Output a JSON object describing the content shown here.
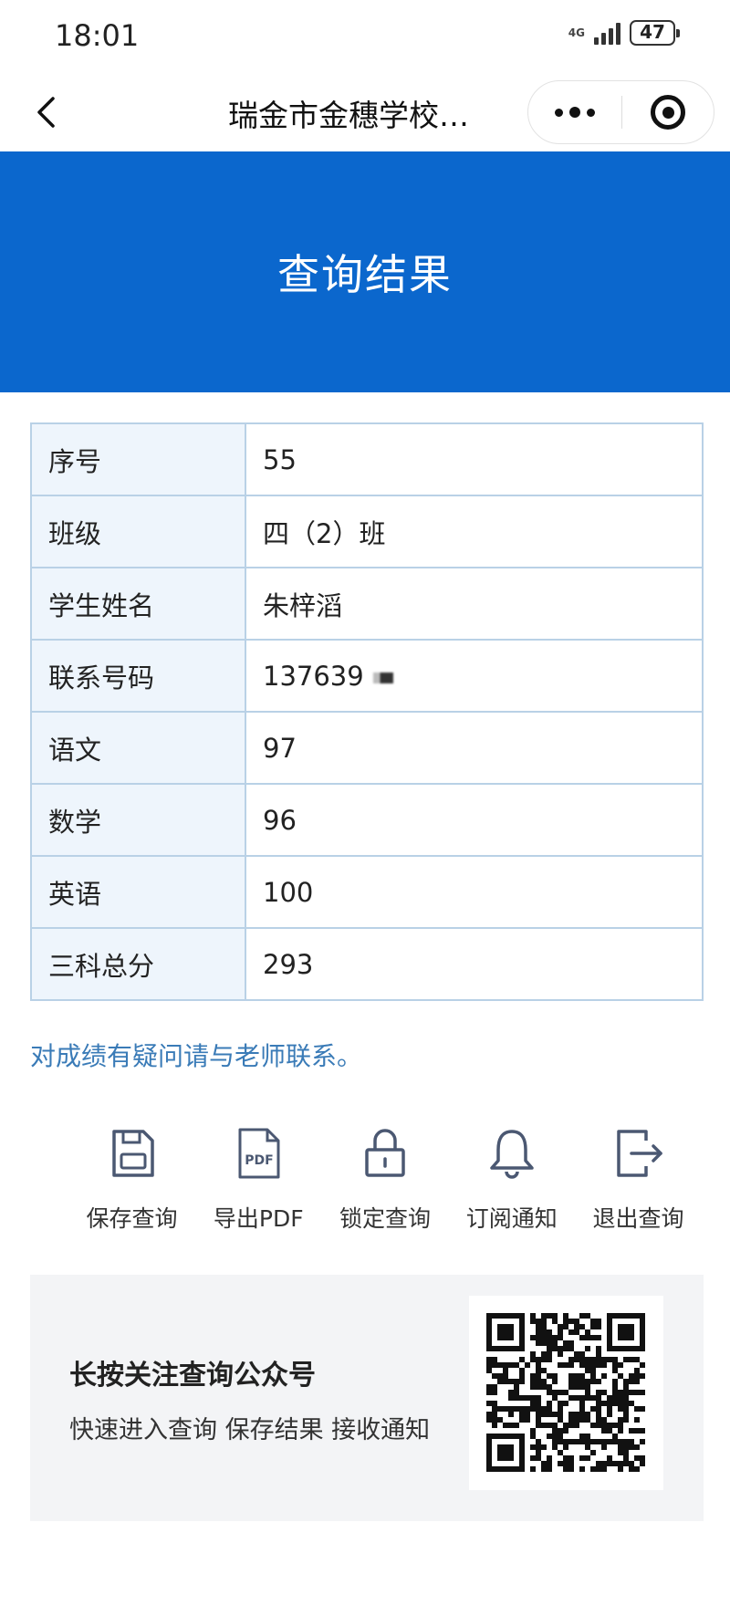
{
  "status_bar": {
    "time": "18:01",
    "network": "4G",
    "battery": "47"
  },
  "nav": {
    "title": "瑞金市金穗学校…"
  },
  "banner": {
    "title": "查询结果"
  },
  "result_rows": [
    {
      "label": "序号",
      "value": "55"
    },
    {
      "label": "班级",
      "value": "四（2）班"
    },
    {
      "label": "学生姓名",
      "value": "朱梓滔"
    },
    {
      "label": "联系号码",
      "value": "137639"
    },
    {
      "label": "语文",
      "value": "97"
    },
    {
      "label": "数学",
      "value": "96"
    },
    {
      "label": "英语",
      "value": "100"
    },
    {
      "label": "三科总分",
      "value": "293"
    }
  ],
  "notice": "对成绩有疑问请与老师联系。",
  "actions": [
    {
      "label": "保存查询",
      "icon": "save-icon"
    },
    {
      "label": "导出PDF",
      "icon": "pdf-icon"
    },
    {
      "label": "锁定查询",
      "icon": "lock-icon"
    },
    {
      "label": "订阅通知",
      "icon": "bell-icon"
    },
    {
      "label": "退出查询",
      "icon": "exit-icon"
    }
  ],
  "promo": {
    "title": "长按关注查询公众号",
    "subtitle": "快速进入查询 保存结果 接收通知"
  },
  "colors": {
    "banner": "#0b67cd",
    "notice": "#3a7bb7",
    "icon": "#4b5872",
    "table_border": "#b9d1e6",
    "label_bg": "#eef5fc"
  }
}
